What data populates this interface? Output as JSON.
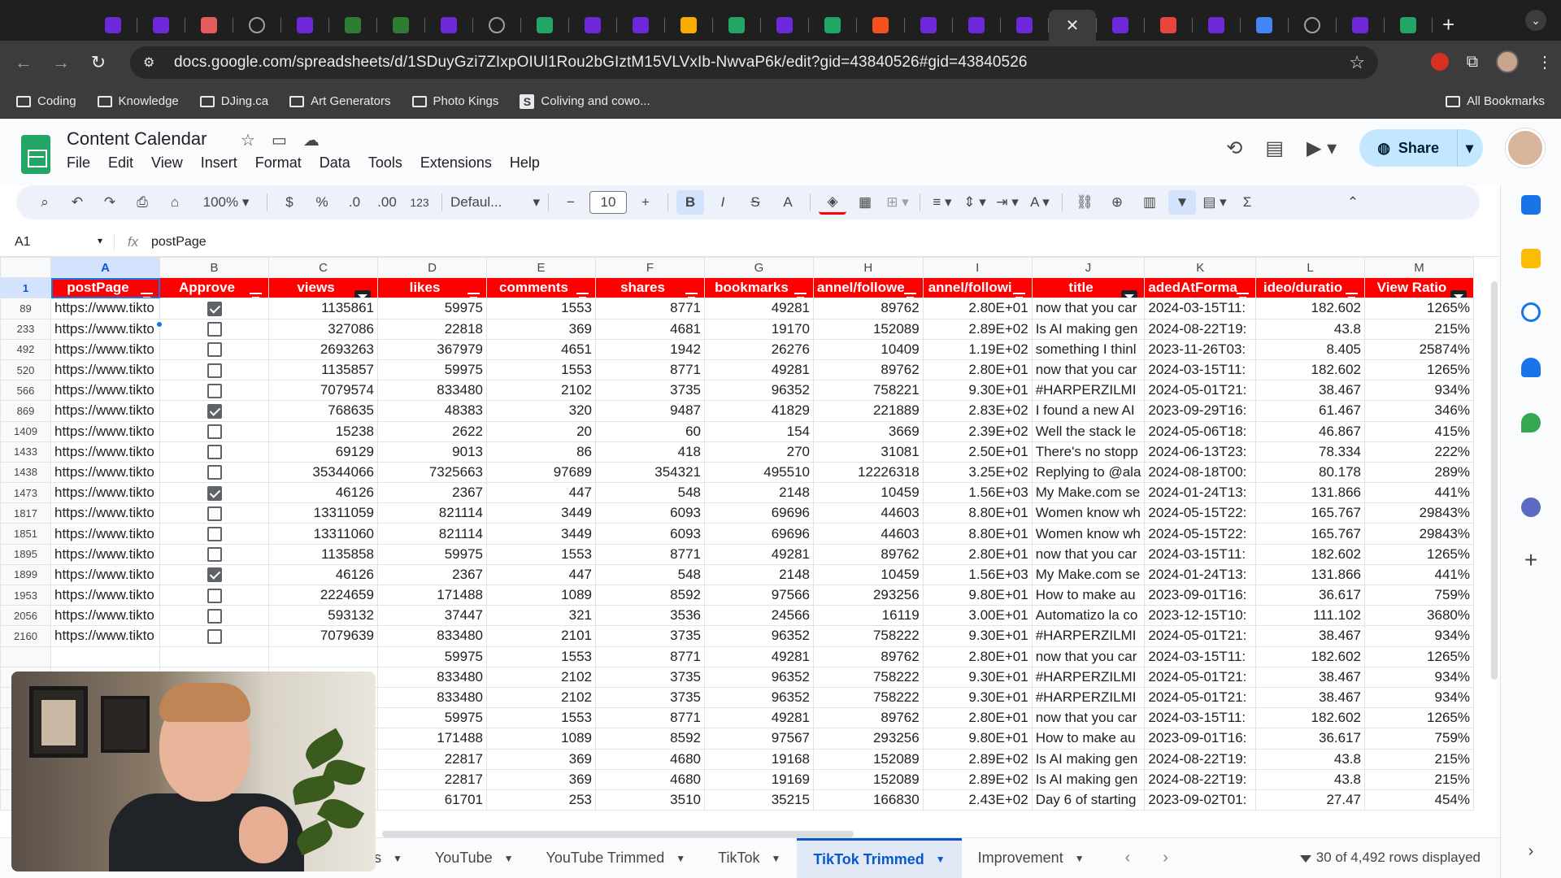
{
  "browser": {
    "tab_favicons": [
      {
        "type": "make",
        "color": "#6d28d9"
      },
      {
        "type": "make",
        "color": "#6d28d9"
      },
      {
        "type": "cat",
        "color": "#e25c5c"
      },
      {
        "type": "circle",
        "color": "#9aa0a6"
      },
      {
        "type": "make",
        "color": "#6d28d9"
      },
      {
        "type": "pd",
        "color": "#2e7d32"
      },
      {
        "type": "pd",
        "color": "#2e7d32"
      },
      {
        "type": "make",
        "color": "#6d28d9"
      },
      {
        "type": "circle",
        "color": "#9aa0a6"
      },
      {
        "type": "sheets",
        "color": "#23a566"
      },
      {
        "type": "make",
        "color": "#6d28d9"
      },
      {
        "type": "make",
        "color": "#6d28d9"
      },
      {
        "type": "yellow",
        "color": "#f9ab00"
      },
      {
        "type": "sheets",
        "color": "#23a566"
      },
      {
        "type": "make",
        "color": "#6d28d9"
      },
      {
        "type": "sheets",
        "color": "#23a566"
      },
      {
        "type": "orange",
        "color": "#f4511e"
      },
      {
        "type": "make",
        "color": "#6d28d9"
      },
      {
        "type": "make",
        "color": "#6d28d9"
      },
      {
        "type": "make",
        "color": "#6d28d9"
      },
      {
        "type": "active-close",
        "color": "#3c3c3c"
      },
      {
        "type": "make",
        "color": "#6d28d9"
      },
      {
        "type": "red",
        "color": "#e8453c"
      },
      {
        "type": "make",
        "color": "#6d28d9"
      },
      {
        "type": "blue",
        "color": "#4285f4"
      },
      {
        "type": "circle",
        "color": "#9aa0a6"
      },
      {
        "type": "make",
        "color": "#6d28d9"
      },
      {
        "type": "sheets",
        "color": "#23a566"
      }
    ],
    "url": "docs.google.com/spreadsheets/d/1SDuyGzi7ZIxpOIUl1Rou2bGIztM15VLVxIb-NwvaP6k/edit?gid=43840526#gid=43840526",
    "bookmarks": [
      "Coding",
      "Knowledge",
      "DJing.ca",
      "Art Generators",
      "Photo Kings",
      "Coliving and cowo..."
    ],
    "all_bookmarks": "All Bookmarks"
  },
  "sheets": {
    "title": "Content Calendar",
    "menu": [
      "File",
      "Edit",
      "View",
      "Insert",
      "Format",
      "Data",
      "Tools",
      "Extensions",
      "Help"
    ],
    "share_label": "Share",
    "toolbar": {
      "zoom": "100%",
      "currency": "$",
      "percent": "%",
      "dec_decrease": ".0",
      "dec_increase": ".00",
      "number_format": "123",
      "font": "Defaul...",
      "font_size": "10"
    },
    "formula": {
      "cell_ref": "A1",
      "fx": "fx",
      "value": "postPage"
    },
    "columns": [
      "A",
      "B",
      "C",
      "D",
      "E",
      "F",
      "G",
      "H",
      "I",
      "J",
      "K",
      "L",
      "M"
    ],
    "header_row_num": "1",
    "headers": [
      {
        "label": "postPage",
        "filter": "lines"
      },
      {
        "label": "Approve",
        "filter": "lines"
      },
      {
        "label": "views",
        "filter": "funnel"
      },
      {
        "label": "likes",
        "filter": "lines"
      },
      {
        "label": "comments",
        "filter": "lines"
      },
      {
        "label": "shares",
        "filter": "lines"
      },
      {
        "label": "bookmarks",
        "filter": "lines"
      },
      {
        "label": "annel/followe",
        "filter": "lines"
      },
      {
        "label": "annel/followi",
        "filter": "lines"
      },
      {
        "label": "title",
        "filter": "funnel"
      },
      {
        "label": "adedAtForma",
        "filter": "lines"
      },
      {
        "label": "ideo/duratio",
        "filter": "lines"
      },
      {
        "label": "View Ratio",
        "filter": "funnel"
      }
    ],
    "rows": [
      {
        "n": "89",
        "a": "https://www.tikto",
        "b": true,
        "c": "1135861",
        "d": "59975",
        "e": "1553",
        "f": "8771",
        "g": "49281",
        "h": "89762",
        "i": "2.80E+01",
        "j": "now that you car",
        "k": "2024-03-15T11:",
        "l": "182.602",
        "m": "1265%"
      },
      {
        "n": "233",
        "a": "https://www.tikto",
        "b": false,
        "c": "327086",
        "d": "22818",
        "e": "369",
        "f": "4681",
        "g": "19170",
        "h": "152089",
        "i": "2.89E+02",
        "j": "Is AI making gen",
        "k": "2024-08-22T19:",
        "l": "43.8",
        "m": "215%"
      },
      {
        "n": "492",
        "a": "https://www.tikto",
        "b": false,
        "c": "2693263",
        "d": "367979",
        "e": "4651",
        "f": "1942",
        "g": "26276",
        "h": "10409",
        "i": "1.19E+02",
        "j": "something I thinl",
        "k": "2023-11-26T03:",
        "l": "8.405",
        "m": "25874%"
      },
      {
        "n": "520",
        "a": "https://www.tikto",
        "b": false,
        "c": "1135857",
        "d": "59975",
        "e": "1553",
        "f": "8771",
        "g": "49281",
        "h": "89762",
        "i": "2.80E+01",
        "j": "now that you car",
        "k": "2024-03-15T11:",
        "l": "182.602",
        "m": "1265%"
      },
      {
        "n": "566",
        "a": "https://www.tikto",
        "b": false,
        "c": "7079574",
        "d": "833480",
        "e": "2102",
        "f": "3735",
        "g": "96352",
        "h": "758221",
        "i": "9.30E+01",
        "j": "#HARPERZILMI",
        "k": "2024-05-01T21:",
        "l": "38.467",
        "m": "934%"
      },
      {
        "n": "869",
        "a": "https://www.tikto",
        "b": true,
        "c": "768635",
        "d": "48383",
        "e": "320",
        "f": "9487",
        "g": "41829",
        "h": "221889",
        "i": "2.83E+02",
        "j": "I found a new AI",
        "k": "2023-09-29T16:",
        "l": "61.467",
        "m": "346%"
      },
      {
        "n": "1409",
        "a": "https://www.tikto",
        "b": false,
        "c": "15238",
        "d": "2622",
        "e": "20",
        "f": "60",
        "g": "154",
        "h": "3669",
        "i": "2.39E+02",
        "j": "Well the stack le",
        "k": "2024-05-06T18:",
        "l": "46.867",
        "m": "415%"
      },
      {
        "n": "1433",
        "a": "https://www.tikto",
        "b": false,
        "c": "69129",
        "d": "9013",
        "e": "86",
        "f": "418",
        "g": "270",
        "h": "31081",
        "i": "2.50E+01",
        "j": "There's no stopp",
        "k": "2024-06-13T23:",
        "l": "78.334",
        "m": "222%"
      },
      {
        "n": "1438",
        "a": "https://www.tikto",
        "b": false,
        "c": "35344066",
        "d": "7325663",
        "e": "97689",
        "f": "354321",
        "g": "495510",
        "h": "12226318",
        "i": "3.25E+02",
        "j": "Replying to @ala",
        "k": "2024-08-18T00:",
        "l": "80.178",
        "m": "289%"
      },
      {
        "n": "1473",
        "a": "https://www.tikto",
        "b": true,
        "c": "46126",
        "d": "2367",
        "e": "447",
        "f": "548",
        "g": "2148",
        "h": "10459",
        "i": "1.56E+03",
        "j": "My Make.com se",
        "k": "2024-01-24T13:",
        "l": "131.866",
        "m": "441%"
      },
      {
        "n": "1817",
        "a": "https://www.tikto",
        "b": false,
        "c": "13311059",
        "d": "821114",
        "e": "3449",
        "f": "6093",
        "g": "69696",
        "h": "44603",
        "i": "8.80E+01",
        "j": "Women know wh",
        "k": "2024-05-15T22:",
        "l": "165.767",
        "m": "29843%"
      },
      {
        "n": "1851",
        "a": "https://www.tikto",
        "b": false,
        "c": "13311060",
        "d": "821114",
        "e": "3449",
        "f": "6093",
        "g": "69696",
        "h": "44603",
        "i": "8.80E+01",
        "j": "Women know wh",
        "k": "2024-05-15T22:",
        "l": "165.767",
        "m": "29843%"
      },
      {
        "n": "1895",
        "a": "https://www.tikto",
        "b": false,
        "c": "1135858",
        "d": "59975",
        "e": "1553",
        "f": "8771",
        "g": "49281",
        "h": "89762",
        "i": "2.80E+01",
        "j": "now that you car",
        "k": "2024-03-15T11:",
        "l": "182.602",
        "m": "1265%"
      },
      {
        "n": "1899",
        "a": "https://www.tikto",
        "b": true,
        "c": "46126",
        "d": "2367",
        "e": "447",
        "f": "548",
        "g": "2148",
        "h": "10459",
        "i": "1.56E+03",
        "j": "My Make.com se",
        "k": "2024-01-24T13:",
        "l": "131.866",
        "m": "441%"
      },
      {
        "n": "1953",
        "a": "https://www.tikto",
        "b": false,
        "c": "2224659",
        "d": "171488",
        "e": "1089",
        "f": "8592",
        "g": "97566",
        "h": "293256",
        "i": "9.80E+01",
        "j": "How to make au",
        "k": "2023-09-01T16:",
        "l": "36.617",
        "m": "759%"
      },
      {
        "n": "2056",
        "a": "https://www.tikto",
        "b": false,
        "c": "593132",
        "d": "37447",
        "e": "321",
        "f": "3536",
        "g": "24566",
        "h": "16119",
        "i": "3.00E+01",
        "j": "Automatizo la co",
        "k": "2023-12-15T10:",
        "l": "111.102",
        "m": "3680%"
      },
      {
        "n": "2160",
        "a": "https://www.tikto",
        "b": false,
        "c": "7079639",
        "d": "833480",
        "e": "2101",
        "f": "3735",
        "g": "96352",
        "h": "758222",
        "i": "9.30E+01",
        "j": "#HARPERZILMI",
        "k": "2024-05-01T21:",
        "l": "38.467",
        "m": "934%"
      },
      {
        "n": "",
        "a": "",
        "b": null,
        "c": "",
        "d": "59975",
        "e": "1553",
        "f": "8771",
        "g": "49281",
        "h": "89762",
        "i": "2.80E+01",
        "j": "now that you car",
        "k": "2024-03-15T11:",
        "l": "182.602",
        "m": "1265%"
      },
      {
        "n": "",
        "a": "",
        "b": null,
        "c": "",
        "d": "833480",
        "e": "2102",
        "f": "3735",
        "g": "96352",
        "h": "758222",
        "i": "9.30E+01",
        "j": "#HARPERZILMI",
        "k": "2024-05-01T21:",
        "l": "38.467",
        "m": "934%"
      },
      {
        "n": "",
        "a": "",
        "b": null,
        "c": "",
        "d": "833480",
        "e": "2102",
        "f": "3735",
        "g": "96352",
        "h": "758222",
        "i": "9.30E+01",
        "j": "#HARPERZILMI",
        "k": "2024-05-01T21:",
        "l": "38.467",
        "m": "934%"
      },
      {
        "n": "",
        "a": "",
        "b": null,
        "c": "",
        "d": "59975",
        "e": "1553",
        "f": "8771",
        "g": "49281",
        "h": "89762",
        "i": "2.80E+01",
        "j": "now that you car",
        "k": "2024-03-15T11:",
        "l": "182.602",
        "m": "1265%"
      },
      {
        "n": "",
        "a": "",
        "b": null,
        "c": "",
        "d": "171488",
        "e": "1089",
        "f": "8592",
        "g": "97567",
        "h": "293256",
        "i": "9.80E+01",
        "j": "How to make au",
        "k": "2023-09-01T16:",
        "l": "36.617",
        "m": "759%"
      },
      {
        "n": "",
        "a": "",
        "b": null,
        "c": "",
        "d": "22817",
        "e": "369",
        "f": "4680",
        "g": "19168",
        "h": "152089",
        "i": "2.89E+02",
        "j": "Is AI making gen",
        "k": "2024-08-22T19:",
        "l": "43.8",
        "m": "215%"
      },
      {
        "n": "",
        "a": "",
        "b": null,
        "c": "",
        "d": "22817",
        "e": "369",
        "f": "4680",
        "g": "19169",
        "h": "152089",
        "i": "2.89E+02",
        "j": "Is AI making gen",
        "k": "2024-08-22T19:",
        "l": "43.8",
        "m": "215%"
      },
      {
        "n": "",
        "a": "",
        "b": null,
        "c": "",
        "d": "61701",
        "e": "253",
        "f": "3510",
        "g": "35215",
        "h": "166830",
        "i": "2.43E+02",
        "j": "Day 6 of starting",
        "k": "2023-09-02T01:",
        "l": "27.47",
        "m": "454%"
      }
    ],
    "sheet_tabs": [
      {
        "label": "s",
        "active": false
      },
      {
        "label": "YouTube",
        "active": false
      },
      {
        "label": "YouTube Trimmed",
        "active": false
      },
      {
        "label": "TikTok",
        "active": false
      },
      {
        "label": "TikTok Trimmed",
        "active": true
      },
      {
        "label": "Improvement",
        "active": false
      }
    ],
    "rows_displayed": "30 of 4,492 rows displayed"
  },
  "colors": {
    "header_red": "#ff0000",
    "sheets_green": "#23a566",
    "selection_blue": "#1a73e8",
    "share_bg": "#c2e7ff"
  }
}
